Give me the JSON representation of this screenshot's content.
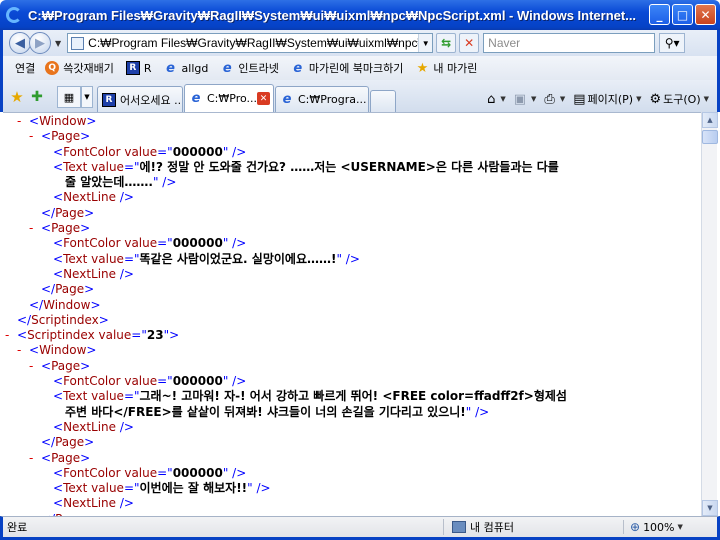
{
  "window": {
    "title": "C:₩Program Files₩Gravity₩RagII₩System₩ui₩uixml₩npc₩NpcScript.xml - Windows Internet..."
  },
  "address_bar": {
    "url": "C:₩Program Files₩Gravity₩RagII₩System₩ui₩uixml₩npc₩Np",
    "search_placeholder": "Naver"
  },
  "links_bar": {
    "label": "연결",
    "items": [
      {
        "label": "쓱갓재배기",
        "icon": "orange-circle-icon"
      },
      {
        "label": "R",
        "icon": "r-logo-icon"
      },
      {
        "label": "allgd",
        "icon": "ie-page-icon"
      },
      {
        "label": "인트라넷",
        "icon": "ie-page-icon"
      },
      {
        "label": "마가린에 북마크하기",
        "icon": "ie-page-icon"
      },
      {
        "label": "내 마가린",
        "icon": "star-icon"
      }
    ]
  },
  "tabs": [
    {
      "label": "어서오세요 ..."
    },
    {
      "label": "C:₩Pro..."
    },
    {
      "label": "C:₩Progra..."
    }
  ],
  "command_bar": {
    "page_label": "페이지(P)",
    "tools_label": "도구(O)"
  },
  "xml_lines": [
    {
      "indent": 2,
      "minus": "-",
      "parts": [
        [
          "br",
          "<"
        ],
        [
          "tag",
          "Window"
        ],
        [
          "br",
          ">"
        ]
      ]
    },
    {
      "indent": 3,
      "minus": "-",
      "parts": [
        [
          "br",
          "<"
        ],
        [
          "tag",
          "Page"
        ],
        [
          "br",
          ">"
        ]
      ]
    },
    {
      "indent": 4,
      "minus": "",
      "parts": [
        [
          "br",
          "<"
        ],
        [
          "tag",
          "FontColor "
        ],
        [
          "attr",
          "value"
        ],
        [
          "br",
          "=\""
        ],
        [
          "val",
          "000000"
        ],
        [
          "br",
          "\" />"
        ]
      ]
    },
    {
      "indent": 4,
      "minus": "",
      "parts": [
        [
          "br",
          "<"
        ],
        [
          "tag",
          "Text "
        ],
        [
          "attr",
          "value"
        ],
        [
          "br",
          "=\""
        ],
        [
          "val",
          "에!? 정말 안 도와줄 건가요? ……저는 <USERNAME>은 다른 사람들과는 다를"
        ]
      ]
    },
    {
      "indent": 5,
      "minus": "",
      "parts": [
        [
          "val",
          "줄 알았는데……."
        ],
        [
          "br",
          "\" />"
        ]
      ]
    },
    {
      "indent": 4,
      "minus": "",
      "parts": [
        [
          "br",
          "<"
        ],
        [
          "tag",
          "NextLine"
        ],
        [
          "br",
          " />"
        ]
      ]
    },
    {
      "indent": 3,
      "minus": "",
      "parts": [
        [
          "br",
          "</"
        ],
        [
          "tag",
          "Page"
        ],
        [
          "br",
          ">"
        ]
      ]
    },
    {
      "indent": 3,
      "minus": "-",
      "parts": [
        [
          "br",
          "<"
        ],
        [
          "tag",
          "Page"
        ],
        [
          "br",
          ">"
        ]
      ]
    },
    {
      "indent": 4,
      "minus": "",
      "parts": [
        [
          "br",
          "<"
        ],
        [
          "tag",
          "FontColor "
        ],
        [
          "attr",
          "value"
        ],
        [
          "br",
          "=\""
        ],
        [
          "val",
          "000000"
        ],
        [
          "br",
          "\" />"
        ]
      ]
    },
    {
      "indent": 4,
      "minus": "",
      "parts": [
        [
          "br",
          "<"
        ],
        [
          "tag",
          "Text "
        ],
        [
          "attr",
          "value"
        ],
        [
          "br",
          "=\""
        ],
        [
          "val",
          "똑같은 사람이었군요. 실망이에요……!"
        ],
        [
          "br",
          "\" />"
        ]
      ]
    },
    {
      "indent": 4,
      "minus": "",
      "parts": [
        [
          "br",
          "<"
        ],
        [
          "tag",
          "NextLine"
        ],
        [
          "br",
          " />"
        ]
      ]
    },
    {
      "indent": 3,
      "minus": "",
      "parts": [
        [
          "br",
          "</"
        ],
        [
          "tag",
          "Page"
        ],
        [
          "br",
          ">"
        ]
      ]
    },
    {
      "indent": 2,
      "minus": "",
      "parts": [
        [
          "br",
          "</"
        ],
        [
          "tag",
          "Window"
        ],
        [
          "br",
          ">"
        ]
      ]
    },
    {
      "indent": 1,
      "minus": "",
      "parts": [
        [
          "br",
          "</"
        ],
        [
          "tag",
          "Scriptindex"
        ],
        [
          "br",
          ">"
        ]
      ]
    },
    {
      "indent": 1,
      "minus": "-",
      "parts": [
        [
          "br",
          "<"
        ],
        [
          "tag",
          "Scriptindex "
        ],
        [
          "attr",
          "value"
        ],
        [
          "br",
          "=\""
        ],
        [
          "val",
          "23"
        ],
        [
          "br",
          "\">"
        ]
      ]
    },
    {
      "indent": 2,
      "minus": "-",
      "parts": [
        [
          "br",
          "<"
        ],
        [
          "tag",
          "Window"
        ],
        [
          "br",
          ">"
        ]
      ]
    },
    {
      "indent": 3,
      "minus": "-",
      "parts": [
        [
          "br",
          "<"
        ],
        [
          "tag",
          "Page"
        ],
        [
          "br",
          ">"
        ]
      ]
    },
    {
      "indent": 4,
      "minus": "",
      "parts": [
        [
          "br",
          "<"
        ],
        [
          "tag",
          "FontColor "
        ],
        [
          "attr",
          "value"
        ],
        [
          "br",
          "=\""
        ],
        [
          "val",
          "000000"
        ],
        [
          "br",
          "\" />"
        ]
      ]
    },
    {
      "indent": 4,
      "minus": "",
      "parts": [
        [
          "br",
          "<"
        ],
        [
          "tag",
          "Text "
        ],
        [
          "attr",
          "value"
        ],
        [
          "br",
          "=\""
        ],
        [
          "val",
          "그래~! 고마워! 자-! 어서 강하고 빠르게 뛰어! <FREE color=ffadff2f>형제섬"
        ]
      ]
    },
    {
      "indent": 5,
      "minus": "",
      "parts": [
        [
          "val",
          "주변 바다</FREE>를 샅샅이 뒤져봐! 샤크들이 너의 손길을 기다리고 있으니!"
        ],
        [
          "br",
          "\" />"
        ]
      ]
    },
    {
      "indent": 4,
      "minus": "",
      "parts": [
        [
          "br",
          "<"
        ],
        [
          "tag",
          "NextLine"
        ],
        [
          "br",
          " />"
        ]
      ]
    },
    {
      "indent": 3,
      "minus": "",
      "parts": [
        [
          "br",
          "</"
        ],
        [
          "tag",
          "Page"
        ],
        [
          "br",
          ">"
        ]
      ]
    },
    {
      "indent": 3,
      "minus": "-",
      "parts": [
        [
          "br",
          "<"
        ],
        [
          "tag",
          "Page"
        ],
        [
          "br",
          ">"
        ]
      ]
    },
    {
      "indent": 4,
      "minus": "",
      "parts": [
        [
          "br",
          "<"
        ],
        [
          "tag",
          "FontColor "
        ],
        [
          "attr",
          "value"
        ],
        [
          "br",
          "=\""
        ],
        [
          "val",
          "000000"
        ],
        [
          "br",
          "\" />"
        ]
      ]
    },
    {
      "indent": 4,
      "minus": "",
      "parts": [
        [
          "br",
          "<"
        ],
        [
          "tag",
          "Text "
        ],
        [
          "attr",
          "value"
        ],
        [
          "br",
          "=\""
        ],
        [
          "val",
          "이번에는 잘 해보자!!"
        ],
        [
          "br",
          "\" />"
        ]
      ]
    },
    {
      "indent": 4,
      "minus": "",
      "parts": [
        [
          "br",
          "<"
        ],
        [
          "tag",
          "NextLine"
        ],
        [
          "br",
          " />"
        ]
      ]
    },
    {
      "indent": 3,
      "minus": "",
      "parts": [
        [
          "br",
          "</"
        ],
        [
          "tag",
          "P"
        ]
      ]
    }
  ],
  "status_bar": {
    "text": "완료",
    "zone": "내 컴퓨터",
    "zoom": "100%"
  }
}
